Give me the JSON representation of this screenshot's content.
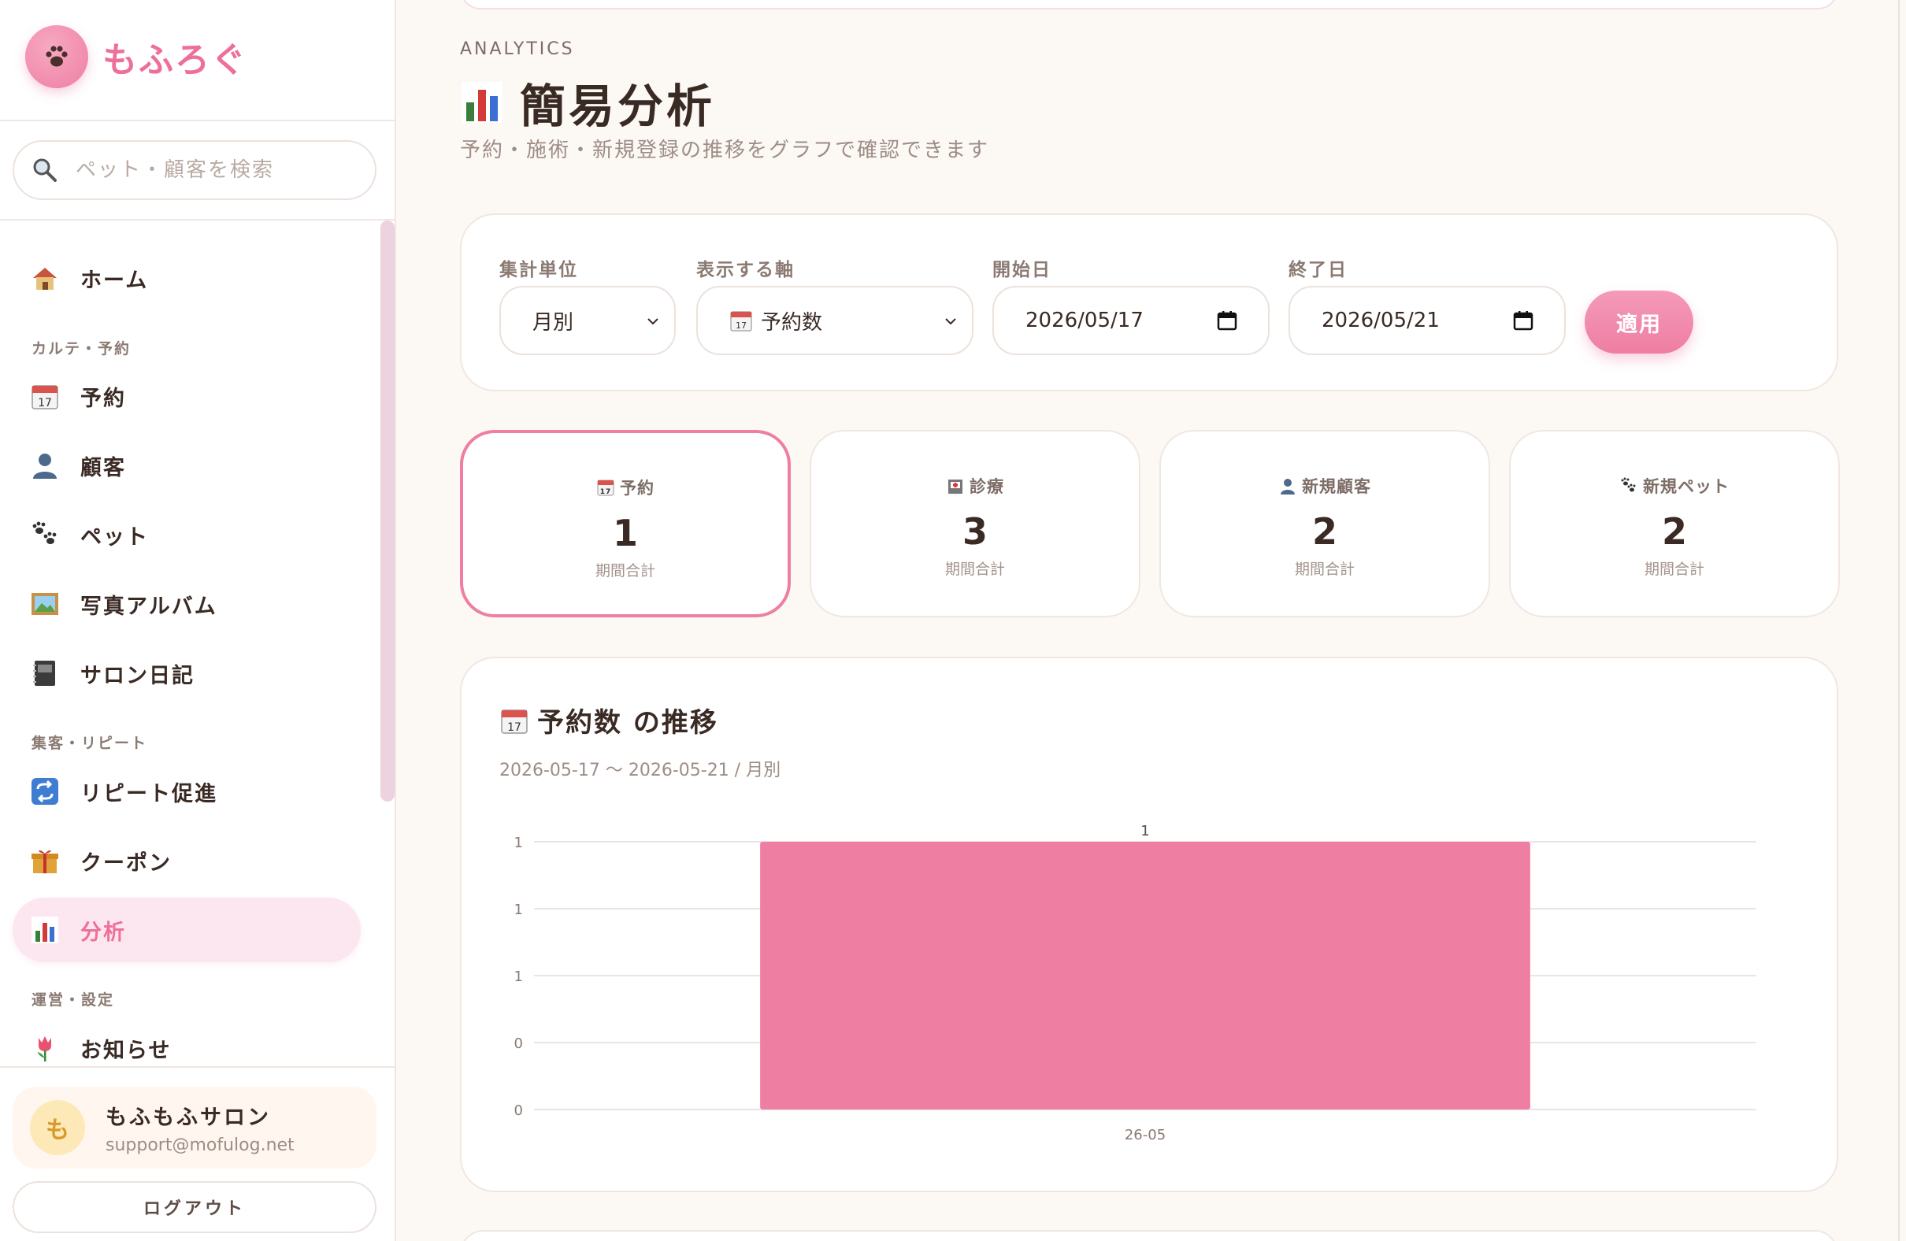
{
  "brand": {
    "name": "もふろぐ"
  },
  "search": {
    "placeholder": "ペット・顧客を検索"
  },
  "sidebar": {
    "sections": [
      "カルテ・予約",
      "集客・リピート",
      "運営・設定"
    ],
    "items": [
      {
        "label": "ホーム",
        "icon": "house-icon"
      },
      {
        "label": "予約",
        "icon": "calendar-icon"
      },
      {
        "label": "顧客",
        "icon": "person-icon"
      },
      {
        "label": "ペット",
        "icon": "paw-icon"
      },
      {
        "label": "写真アルバム",
        "icon": "picture-icon"
      },
      {
        "label": "サロン日記",
        "icon": "notebook-icon"
      },
      {
        "label": "リピート促進",
        "icon": "repeat-icon"
      },
      {
        "label": "クーポン",
        "icon": "gift-icon"
      },
      {
        "label": "分析",
        "icon": "bar-chart-icon",
        "active": true
      },
      {
        "label": "お知らせ",
        "icon": "tulip-icon"
      }
    ]
  },
  "user": {
    "avatar": "も",
    "name": "もふもふサロン",
    "email": "support@mofulog.net"
  },
  "logout_label": "ログアウト",
  "page": {
    "overline": "ANALYTICS",
    "title": "簡易分析",
    "subtitle": "予約・施術・新規登録の推移をグラフで確認できます"
  },
  "filters": {
    "unit_label": "集計単位",
    "unit_value": "月別",
    "axis_label": "表示する軸",
    "axis_value": "予約数",
    "start_label": "開始日",
    "start_value": "2026/05/17",
    "end_label": "終了日",
    "end_value": "2026/05/21",
    "apply_label": "適用"
  },
  "stats": [
    {
      "label": "予約",
      "value": "1",
      "caption": "期間合計",
      "icon": "calendar-icon",
      "selected": true
    },
    {
      "label": "診療",
      "value": "3",
      "caption": "期間合計",
      "icon": "hospital-icon"
    },
    {
      "label": "新規顧客",
      "value": "2",
      "caption": "期間合計",
      "icon": "person-icon"
    },
    {
      "label": "新規ペット",
      "value": "2",
      "caption": "期間合計",
      "icon": "paw-icon"
    }
  ],
  "chart": {
    "heading": "予約数 の推移",
    "range": "2026-05-17 〜 2026-05-21 / 月別"
  },
  "colors": {
    "accent": "#ee7ea2",
    "bar": "#ee7ea2",
    "text": "#3a2a24",
    "background": "#fcf8f4"
  },
  "chart_data": {
    "type": "bar",
    "categories": [
      "26-05"
    ],
    "values": [
      1
    ],
    "data_labels": [
      "1"
    ],
    "y_tick_labels": [
      "0",
      "0",
      "1",
      "1",
      "1"
    ],
    "ylim": [
      0,
      1
    ],
    "grid": true,
    "title": "予約数 の推移"
  }
}
